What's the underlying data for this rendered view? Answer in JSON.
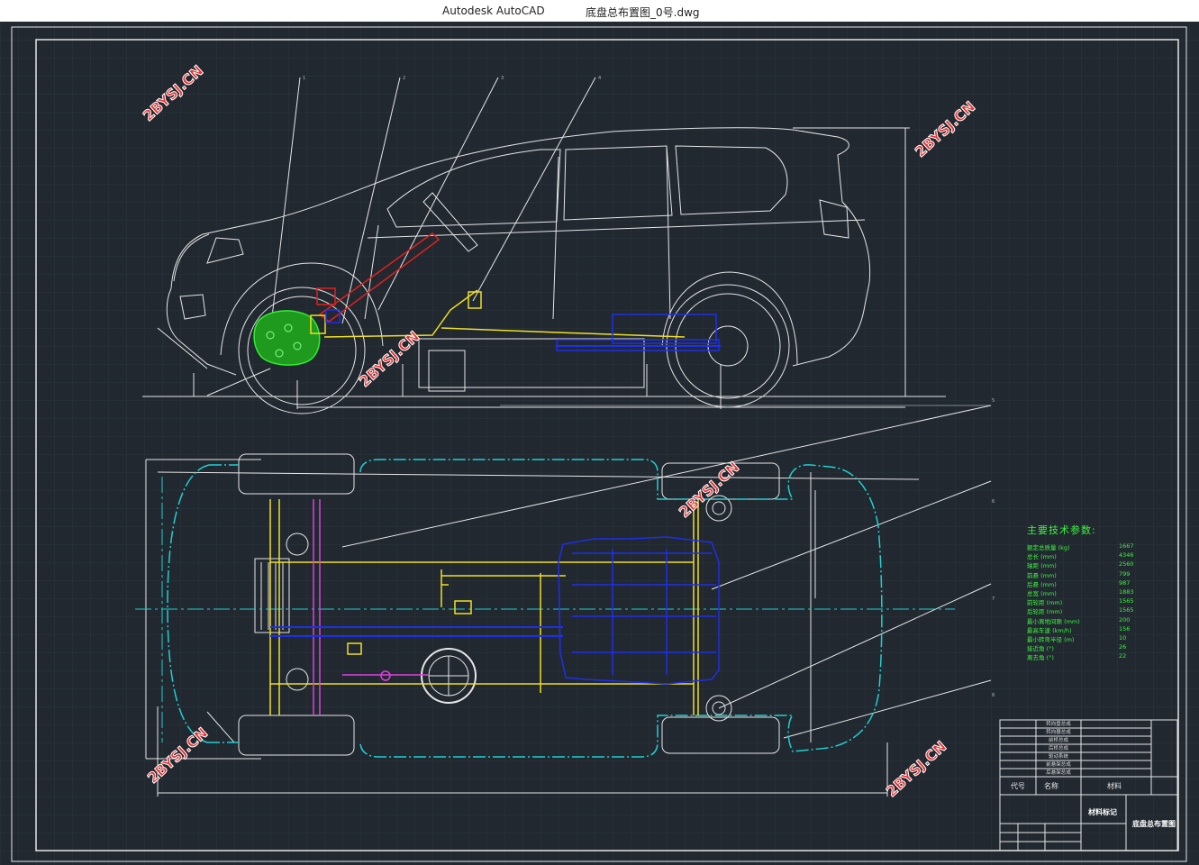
{
  "window": {
    "app_name": "Autodesk AutoCAD",
    "file_name": "底盘总布置图_0号.dwg"
  },
  "colors": {
    "background": "#212830",
    "line_white": "#e6e6e6",
    "green_part": "#2ef02e",
    "yellow_part": "#f0e020",
    "blue_part": "#1f2fe8",
    "red_part": "#e02020",
    "cyan_part": "#20d0d0",
    "magenta_part": "#e040e0",
    "watermark_red": "#e83030",
    "param_text": "#3cf53c"
  },
  "watermark": {
    "text": "2BYSJ.CN"
  },
  "leader_labels": {
    "top": [
      "1",
      "2",
      "3",
      "4"
    ],
    "bottom": [
      "5",
      "6",
      "7",
      "8"
    ]
  },
  "tech_params": {
    "title": "主要技术参数:",
    "rows": [
      {
        "label": "额定总质量 (kg)",
        "value": "1667"
      },
      {
        "label": "总长 (mm)",
        "value": "4346"
      },
      {
        "label": "轴距 (mm)",
        "value": "2560"
      },
      {
        "label": "前悬 (mm)",
        "value": "799"
      },
      {
        "label": "后悬 (mm)",
        "value": "987"
      },
      {
        "label": "总宽 (mm)",
        "value": "1883"
      },
      {
        "label": "前轮距 (mm)",
        "value": "1565"
      },
      {
        "label": "后轮距 (mm)",
        "value": "1565"
      },
      {
        "label": "最小离地间隙 (mm)",
        "value": "200"
      },
      {
        "label": "最高车速 (km/h)",
        "value": "156"
      },
      {
        "label": "最小转弯半径 (m)",
        "value": "10"
      },
      {
        "label": "接近角 (°)",
        "value": "26"
      },
      {
        "label": "离去角 (°)",
        "value": "22"
      }
    ]
  },
  "title_block": {
    "parts_list": [
      "转向盘总成",
      "转向器总成",
      "前桥总成",
      "后桥总成",
      "驱动系统",
      "前悬架总成",
      "后悬架总成"
    ],
    "headers": {
      "code": "代号",
      "name": "名称",
      "material": "材料"
    },
    "material_mark": "材料标记",
    "drawing_title": "底盘总布置图"
  }
}
